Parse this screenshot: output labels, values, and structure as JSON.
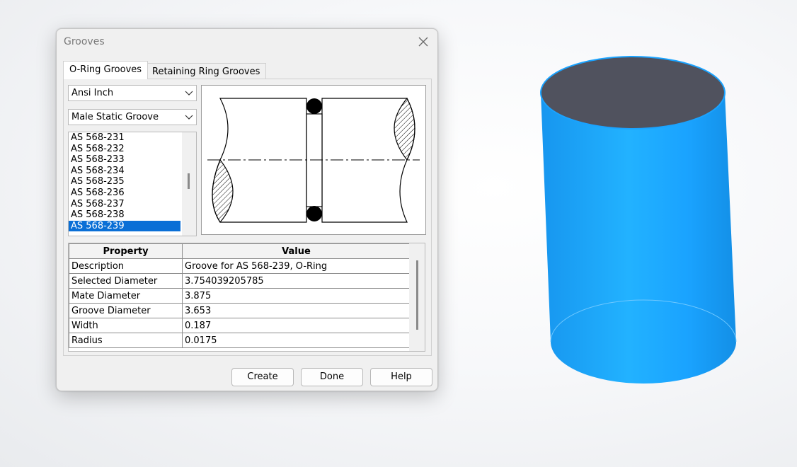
{
  "dialog": {
    "title": "Grooves",
    "close_icon": "close-icon",
    "tabs": [
      {
        "label": "O-Ring Grooves",
        "active": true
      },
      {
        "label": "Retaining Ring Grooves",
        "active": false
      }
    ],
    "standard_select": {
      "value": "Ansi Inch"
    },
    "type_select": {
      "value": "Male Static Groove"
    },
    "size_list": {
      "items": [
        "AS 568-231",
        "AS 568-232",
        "AS 568-233",
        "AS 568-234",
        "AS 568-235",
        "AS 568-236",
        "AS 568-237",
        "AS 568-238",
        "AS 568-239"
      ],
      "selected": "AS 568-239"
    },
    "properties": {
      "headers": [
        "Property",
        "Value"
      ],
      "rows": [
        [
          "Description",
          "Groove for AS 568-239, O-Ring"
        ],
        [
          "Selected Diameter",
          "3.754039205785"
        ],
        [
          "Mate Diameter",
          "3.875"
        ],
        [
          "Groove Diameter",
          "3.653"
        ],
        [
          "Width",
          "0.187"
        ],
        [
          "Radius",
          "0.0175"
        ]
      ]
    },
    "buttons": {
      "create": "Create",
      "done": "Done",
      "help": "Help"
    }
  },
  "colors": {
    "selection": "#0a6fd6",
    "cylinder_body": "#1aa3ff",
    "cylinder_top": "#50525e"
  }
}
